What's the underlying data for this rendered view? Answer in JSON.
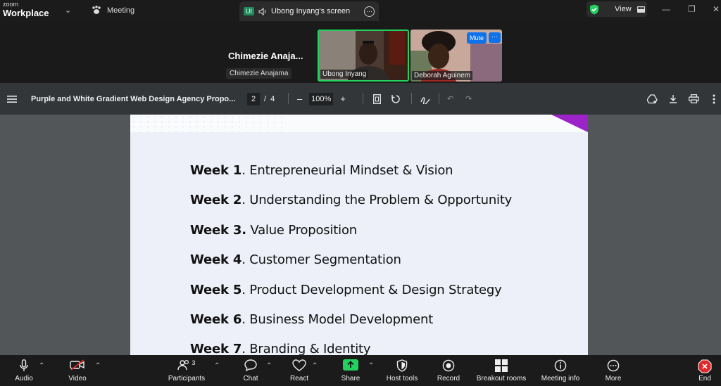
{
  "app": {
    "brand_small": "zoom",
    "brand_main": "Workplace"
  },
  "titlebar": {
    "meeting_label": "Meeting",
    "share_tab": {
      "badge": "UI",
      "label": "Ubong Inyang's screen"
    },
    "view_label": "View"
  },
  "participants_strip": {
    "host_name_truncated": "Chimezie  Anaja...",
    "host_label": "Chimezie Anajama",
    "tiles": [
      {
        "name": "Ubong Inyang",
        "speaking": true
      },
      {
        "name": "Deborah Aguinem",
        "mute_label": "Mute",
        "more_label": "···"
      }
    ]
  },
  "pdf_toolbar": {
    "title": "Purple and White Gradient Web Design Agency Propo...",
    "page_current": "2",
    "page_sep": "/",
    "page_total": "4",
    "zoom": "100%",
    "zoom_out": "–",
    "zoom_in": "+"
  },
  "document": {
    "weeks": [
      {
        "bold": "Week 1",
        "rest": ". Entrepreneurial Mindset & Vision"
      },
      {
        "bold": "Week 2",
        "rest": ". Understanding the Problem & Opportunity"
      },
      {
        "bold": "Week 3.",
        "rest": " Value Proposition"
      },
      {
        "bold": "Week 4",
        "rest": ". Customer Segmentation"
      },
      {
        "bold": "Week 5",
        "rest": ". Product Development & Design Strategy"
      },
      {
        "bold": "Week 6",
        "rest": ". Business Model Development"
      },
      {
        "bold": "Week 7",
        "rest": ". Branding & Identity"
      }
    ],
    "accent_color": "#9b23c8"
  },
  "controls": {
    "audio": "Audio",
    "video": "Video",
    "participants": "Participants",
    "participants_count": "3",
    "chat": "Chat",
    "react": "React",
    "share": "Share",
    "host_tools": "Host tools",
    "record": "Record",
    "breakout_rooms": "Breakout rooms",
    "meeting_info": "Meeting info",
    "more": "More",
    "end": "End",
    "share_color": "#23d160",
    "end_color": "#e02828"
  }
}
